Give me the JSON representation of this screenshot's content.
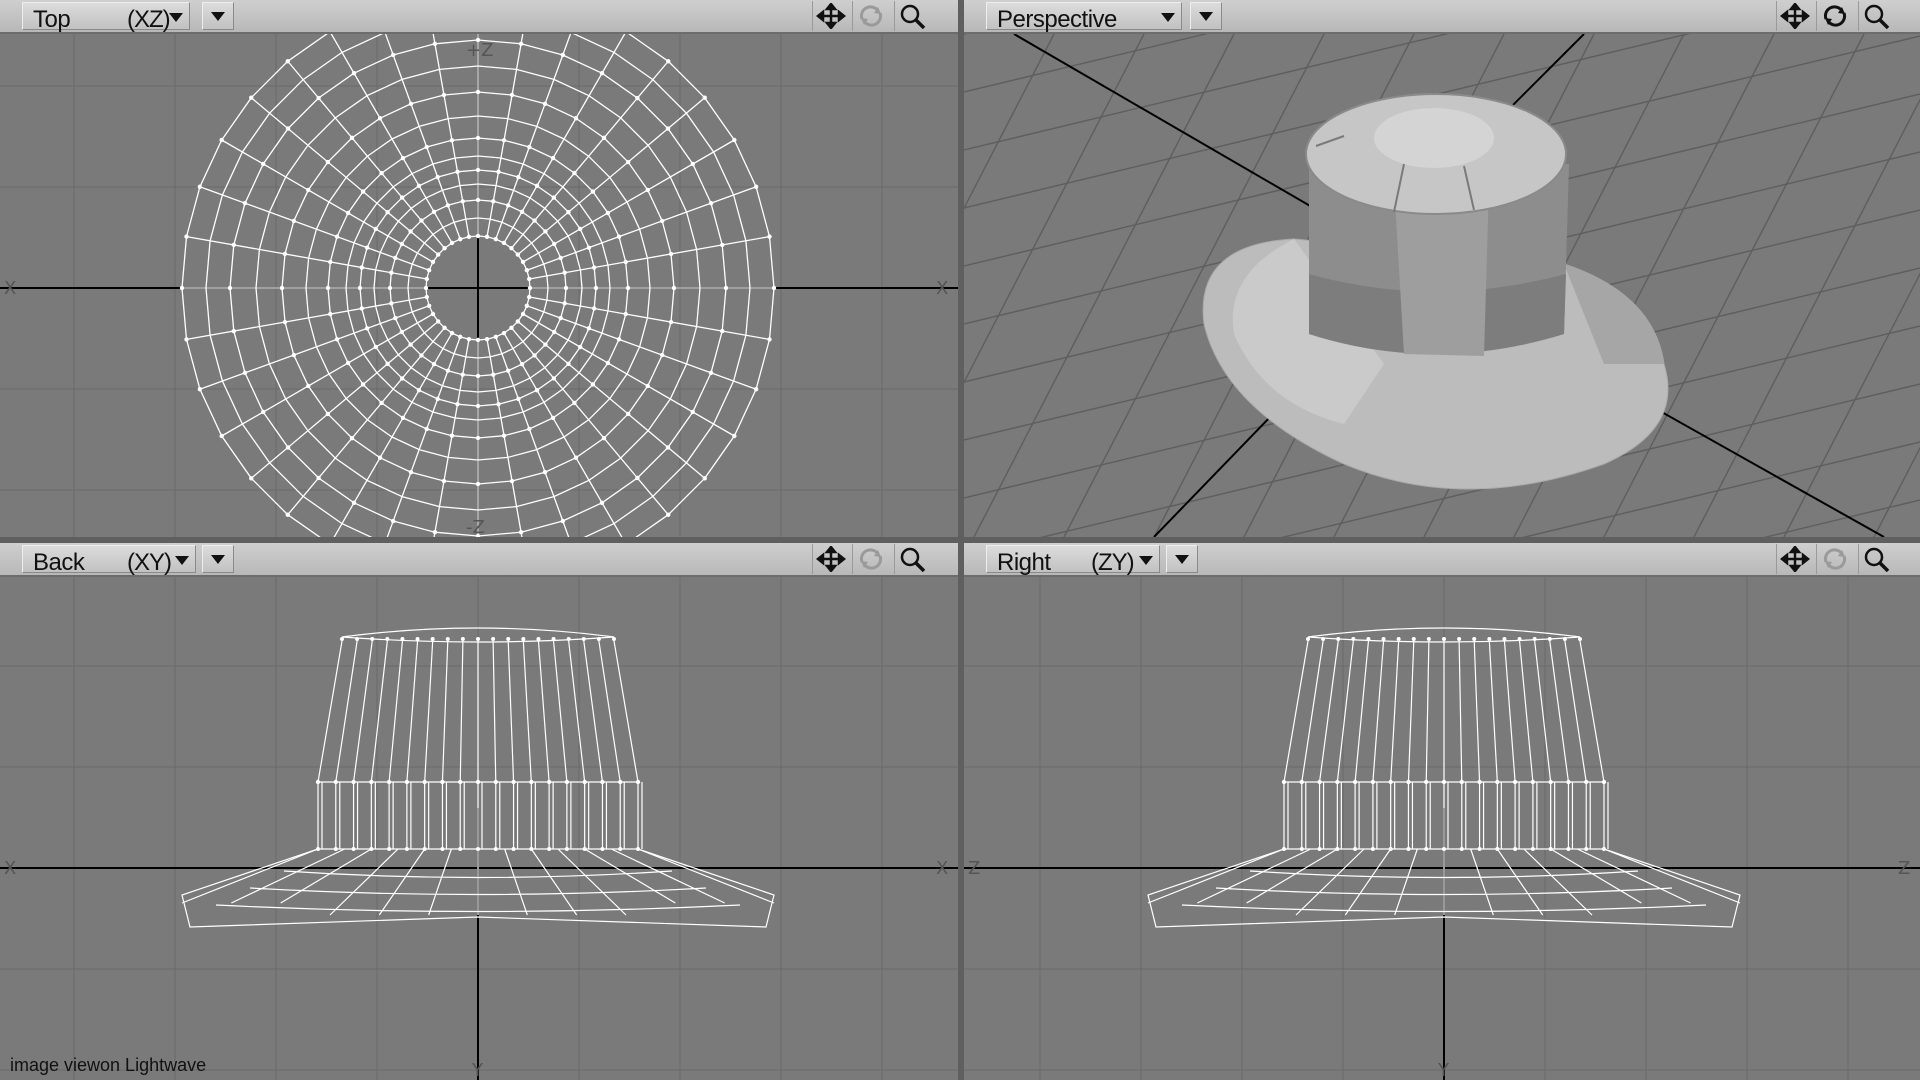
{
  "viewports": {
    "top": {
      "name": "Top",
      "axes": "(XZ)"
    },
    "perspective": {
      "name": "Perspective"
    },
    "back": {
      "name": "Back",
      "axes": "(XY)"
    },
    "right": {
      "name": "Right",
      "axes": "(ZY)"
    }
  },
  "toolbar": {
    "move_icon": "move-arrows-icon",
    "rotate_icon": "rotate-icon",
    "zoom_icon": "magnifier-icon"
  },
  "axis_labels": {
    "top": {
      "left": "X",
      "right": "X",
      "upper": "+Z",
      "lower": "-Z"
    },
    "back": {
      "left": "X",
      "right": "X",
      "lower": "Y"
    },
    "right": {
      "left": "Z",
      "right": "Z",
      "lower": "Y"
    }
  },
  "caption": "image viewon Lightwave",
  "colors": {
    "viewport_bg": "#7a7a7a",
    "grid": "#6a6a6a",
    "wire": "#ffffff",
    "axis": "#000000",
    "toolbar": "#c4c4c4"
  }
}
